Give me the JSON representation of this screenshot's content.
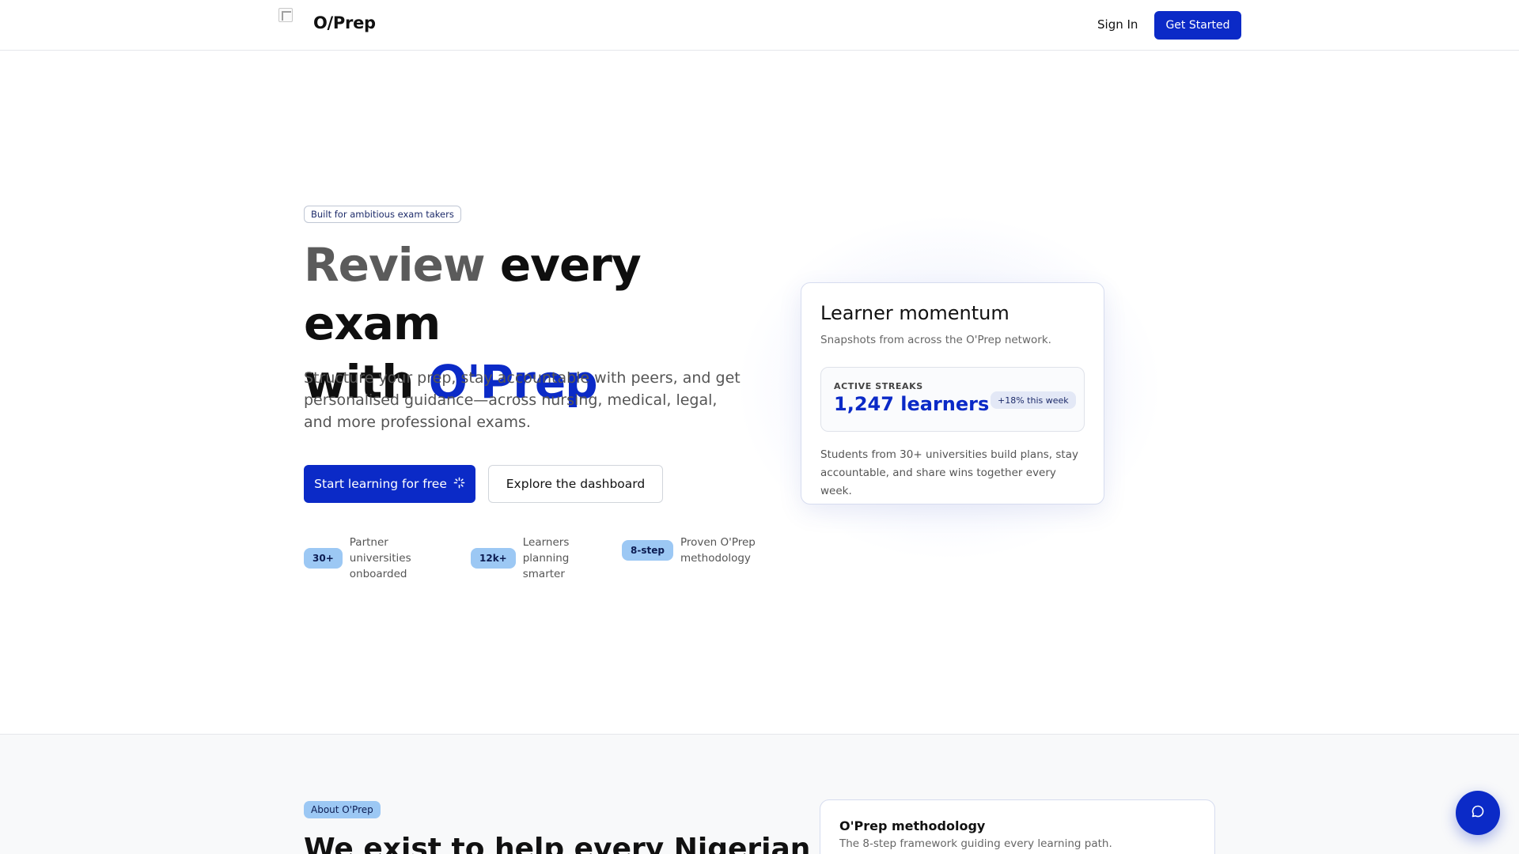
{
  "header": {
    "brand": "O/Prep",
    "signin_label": "Sign In",
    "get_started_label": "Get Started"
  },
  "hero": {
    "pill": "Built for ambitious exam takers",
    "headline": {
      "part1": "Review ",
      "part2": "every exam",
      "part3": "with ",
      "part4": "O'Prep"
    },
    "subtext": "Structure your prep, stay accountable with peers, and get personalised guidance—across nursing, medical, legal, and more professional exams.",
    "primary_cta": "Start learning for free",
    "secondary_cta": "Explore the dashboard",
    "stats": [
      {
        "badge": "30+",
        "label": "Partner universities onboarded"
      },
      {
        "badge": "12k+",
        "label": "Learners planning smarter"
      },
      {
        "badge": "8-step",
        "label": "Proven O'Prep methodology"
      }
    ]
  },
  "momentum": {
    "title": "Learner momentum",
    "subtitle": "Snapshots from across the O'Prep network.",
    "metric_label": "ACTIVE STREAKS",
    "metric_value": "1,247 learners",
    "metric_change": "+18% this week",
    "footer": "Students from 30+ universities build plans, stay accountable, and share wins together every week."
  },
  "about": {
    "pill": "About O'Prep",
    "heading": "We exist to help every Nigerian",
    "method_title": "O'Prep methodology",
    "method_subtitle": "The 8-step framework guiding every learning path."
  },
  "colors": {
    "brand_blue": "#0b2ac7",
    "badge_blue": "#9cc8f4"
  }
}
